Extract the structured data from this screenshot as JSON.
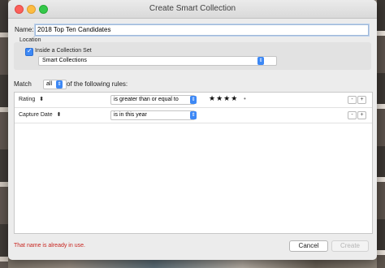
{
  "window": {
    "title": "Create Smart Collection"
  },
  "name": {
    "label": "Name:",
    "value": "2018 Top Ten Candidates"
  },
  "location": {
    "label": "Location",
    "inside_set_label": "Inside a Collection Set",
    "inside_set_checked": true,
    "collection_set": "Smart Collections"
  },
  "match": {
    "prefix": "Match",
    "value": "all",
    "suffix": "of the following rules:"
  },
  "rules": [
    {
      "field": "Rating",
      "operator": "is greater than or equal to",
      "value_stars": "★★★★",
      "value_dot": "•",
      "remove": "-",
      "add": "+"
    },
    {
      "field": "Capture Date",
      "operator": "is in this year",
      "remove": "-",
      "add": "+"
    }
  ],
  "footer": {
    "error": "That name is already in use.",
    "cancel": "Cancel",
    "create": "Create"
  },
  "colors": {
    "accent": "#3d88f5",
    "error": "#c8241e"
  },
  "icons": {
    "popup": "up-down-chevron-icon",
    "checkbox": "checkmark-icon"
  }
}
